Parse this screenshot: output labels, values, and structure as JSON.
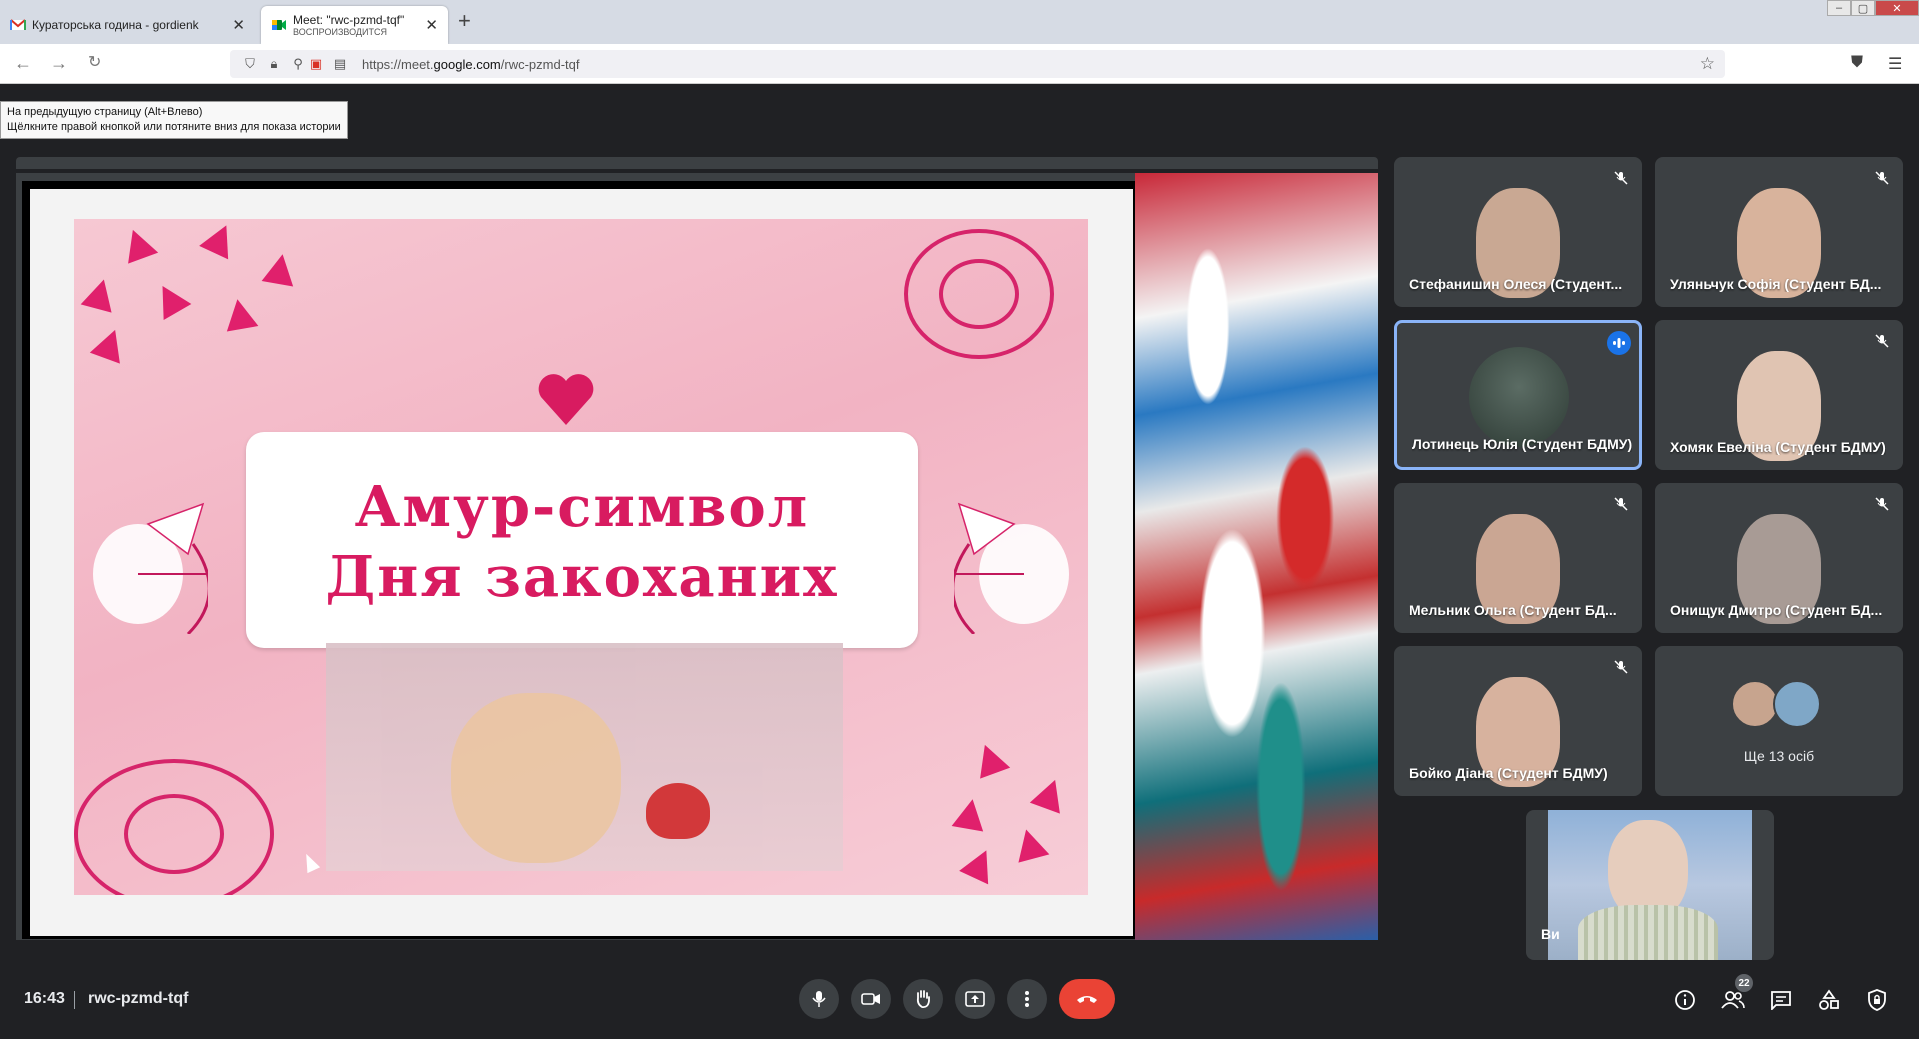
{
  "browser": {
    "tabs": [
      {
        "title": "Кураторська година - gordienk",
        "favicon": "gmail-icon",
        "active": false
      },
      {
        "title": "Meet: \"rwc-pzmd-tqf\"",
        "subtitle": "ВОСПРОИЗВОДИТСЯ",
        "favicon": "meet-icon",
        "active": true
      }
    ],
    "new_tab": "+",
    "url_prefix": "https://meet.",
    "url_domain": "google.com",
    "url_path": "/rwc-pzmd-tqf",
    "tooltip_line1": "На предыдущую страницу (Alt+Влево)",
    "tooltip_line2": "Щёлкните правой кнопкой или потяните вниз для показа истории"
  },
  "slide": {
    "title_line1": "Амур-символ",
    "title_line2": "Дня закоханих"
  },
  "participants": [
    {
      "name": "Стефанишин Олеся (Студент...",
      "muted": true,
      "skin": "#c9a893"
    },
    {
      "name": "Уляньчук Софія (Студент БД...",
      "muted": true,
      "skin": "#d8b39c"
    },
    {
      "name": "Лотинець Юлія (Студент БДМУ)",
      "muted": false,
      "speaking": true
    },
    {
      "name": "Хомяк Евеліна (Студент БДМУ)",
      "muted": true,
      "skin": "#e0c4b2"
    },
    {
      "name": "Мельник Ольга (Студент БД...",
      "muted": true,
      "skin": "#caa693"
    },
    {
      "name": "Онищук Дмитро (Студент БД...",
      "muted": true,
      "skin": "#a89b95"
    },
    {
      "name": "Бойко Діана (Студент БДМУ)",
      "muted": true,
      "skin": "#d7b29e"
    }
  ],
  "more_people": "Ще 13 осіб",
  "self_label": "Ви",
  "bottom": {
    "time": "16:43",
    "meeting_code": "rwc-pzmd-tqf",
    "participants_count": "22"
  },
  "colors": {
    "accent_blue": "#1a73e8",
    "end_call_red": "#ea4335",
    "slide_pink": "#d81b60"
  }
}
